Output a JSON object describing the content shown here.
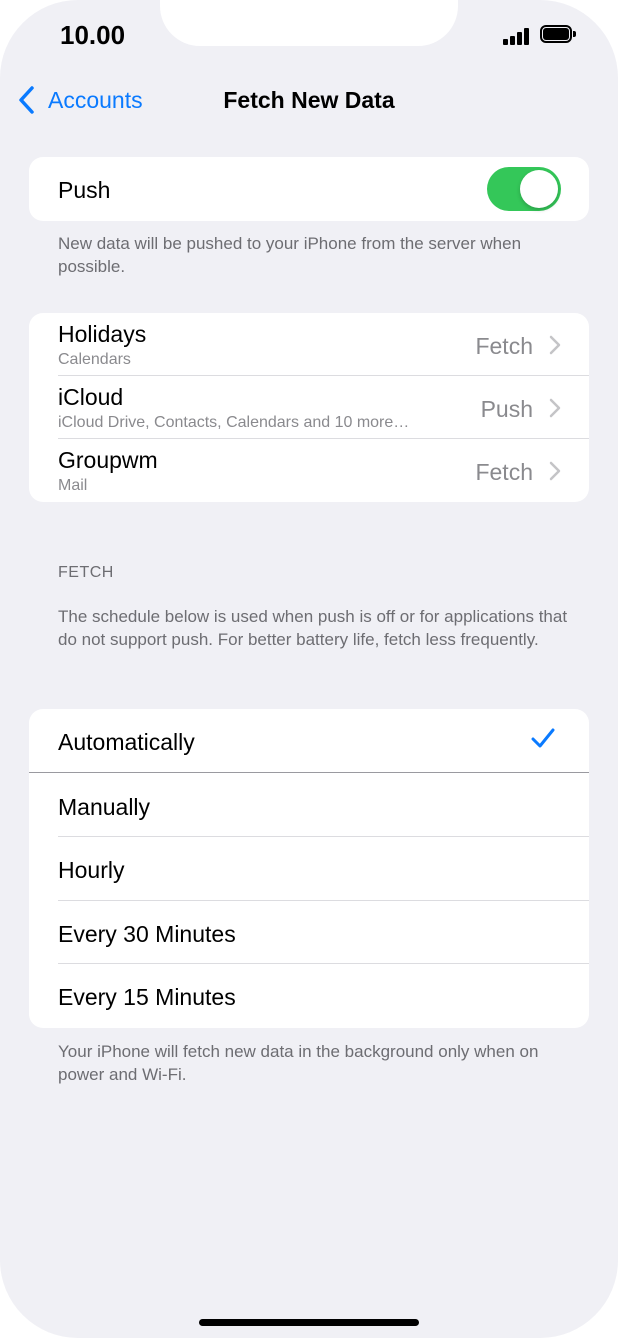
{
  "status_bar": {
    "time": "10.00"
  },
  "nav": {
    "back_label": "Accounts",
    "title": "Fetch New Data"
  },
  "push": {
    "label": "Push",
    "enabled": true,
    "footnote": "New data will be pushed to your iPhone from the server when possible."
  },
  "accounts": [
    {
      "name": "Holidays",
      "detail": "Calendars",
      "value": "Fetch"
    },
    {
      "name": "iCloud",
      "detail": "iCloud Drive, Contacts, Calendars and 10 more…",
      "value": "Push"
    },
    {
      "name": "Groupwm",
      "detail": "Mail",
      "value": "Fetch"
    }
  ],
  "fetch": {
    "header": "FETCH",
    "description": "The schedule below is used when push is off or for applications that do not support push. For better battery life, fetch less frequently.",
    "options": [
      {
        "label": "Automatically",
        "selected": true
      },
      {
        "label": "Manually",
        "selected": false
      },
      {
        "label": "Hourly",
        "selected": false
      },
      {
        "label": "Every 30 Minutes",
        "selected": false
      },
      {
        "label": "Every 15 Minutes",
        "selected": false
      }
    ],
    "footnote": "Your iPhone will fetch new data in the background only when on power and Wi-Fi."
  },
  "colors": {
    "accent": "#0a7aff",
    "toggle_on": "#34c759",
    "background": "#f0f0f5"
  },
  "icons": {
    "back": "chevron-left-icon",
    "disclosure": "chevron-right-icon",
    "selected": "checkmark-icon",
    "signal": "cellular-signal-icon",
    "battery": "battery-icon"
  }
}
